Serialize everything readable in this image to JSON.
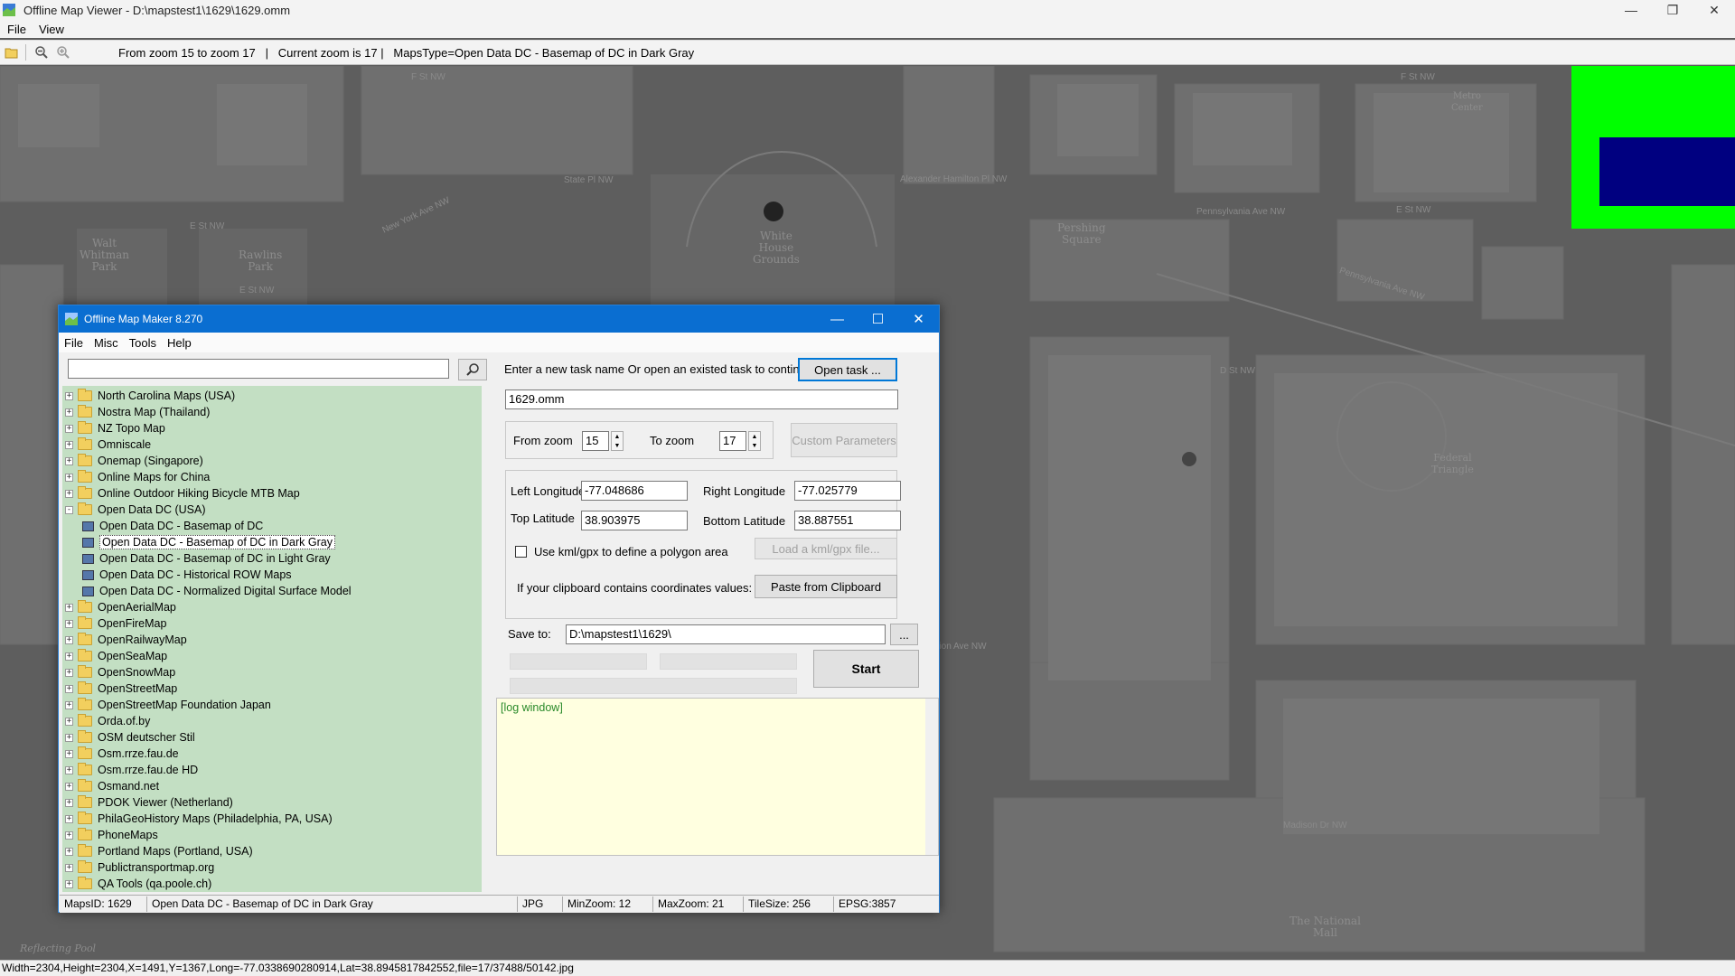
{
  "window": {
    "title": "Offline Map Viewer - D:\\mapstest1\\1629\\1629.omm",
    "controls": [
      "minimize",
      "restore",
      "close"
    ]
  },
  "menu": [
    "File",
    "View"
  ],
  "toolbar": {
    "status": "From zoom 15 to zoom 17   |   Current zoom is 17 |   MapsType=Open Data DC - Basemap of DC in Dark Gray"
  },
  "map": {
    "labels": {
      "walt": "Walt\nWhitman\nPark",
      "rawlins": "Rawlins\nPark",
      "white_house": "White\nHouse\nGrounds",
      "pershing": "Pershing\nSquare",
      "federal": "Federal\nTriangle",
      "national_mall": "The National\nMall",
      "metro": "Metro\nCenter",
      "reflecting": "Reflecting Pool"
    },
    "streets": {
      "f_st_1": "F St NW",
      "f_st_2": "F St NW",
      "e_st_1": "E St NW",
      "e_st_2": "E St NW",
      "e_st_3": "E St NW",
      "state_pl": "State Pl NW",
      "alexander": "Alexander Hamilton Pl NW",
      "penn_1": "Pennsylvania Ave NW",
      "penn_2": "Pennsylvania Ave NW",
      "d_st": "D St NW",
      "madison": "Madison Dr NW",
      "constitution": "Constitution Ave NW",
      "ny_ave": "New York Ave NW"
    },
    "overview_colors": {
      "background": "#00ff00",
      "viewport": "#000080"
    }
  },
  "status_bar": "Width=2304,Height=2304,X=1491,Y=1367,Long=-77.0338690280914,Lat=38.8945817842552,file=17/37488/50142.jpg",
  "dialog": {
    "title": "Offline Map Maker 8.270",
    "menu": [
      "File",
      "Misc",
      "Tools",
      "Help"
    ],
    "search_placeholder": "",
    "tree": [
      {
        "label": "North Carolina Maps (USA)",
        "type": "folder",
        "expander": "+"
      },
      {
        "label": "Nostra Map (Thailand)",
        "type": "folder",
        "expander": "+"
      },
      {
        "label": "NZ Topo Map",
        "type": "folder",
        "expander": "+"
      },
      {
        "label": "Omniscale",
        "type": "folder",
        "expander": "+"
      },
      {
        "label": "Onemap (Singapore)",
        "type": "folder",
        "expander": "+"
      },
      {
        "label": "Online Maps for China",
        "type": "folder",
        "expander": "+"
      },
      {
        "label": "Online Outdoor Hiking Bicycle MTB Map",
        "type": "folder",
        "expander": "+"
      },
      {
        "label": "Open Data DC (USA)",
        "type": "folder-open",
        "expander": "-"
      },
      {
        "label": "Open Data DC - Basemap of DC",
        "type": "map",
        "expander": ""
      },
      {
        "label": "Open Data DC - Basemap of DC in Dark Gray",
        "type": "map",
        "expander": "",
        "selected": true
      },
      {
        "label": "Open Data DC - Basemap of DC in Light Gray",
        "type": "map",
        "expander": ""
      },
      {
        "label": "Open Data DC - Historical ROW Maps",
        "type": "map",
        "expander": ""
      },
      {
        "label": "Open Data DC - Normalized Digital Surface Model",
        "type": "map",
        "expander": ""
      },
      {
        "label": "OpenAerialMap",
        "type": "folder",
        "expander": "+"
      },
      {
        "label": "OpenFireMap",
        "type": "folder",
        "expander": "+"
      },
      {
        "label": "OpenRailwayMap",
        "type": "folder",
        "expander": "+"
      },
      {
        "label": "OpenSeaMap",
        "type": "folder",
        "expander": "+"
      },
      {
        "label": "OpenSnowMap",
        "type": "folder",
        "expander": "+"
      },
      {
        "label": "OpenStreetMap",
        "type": "folder",
        "expander": "+"
      },
      {
        "label": "OpenStreetMap Foundation Japan",
        "type": "folder",
        "expander": "+"
      },
      {
        "label": "Orda.of.by",
        "type": "folder",
        "expander": "+"
      },
      {
        "label": "OSM deutscher Stil",
        "type": "folder",
        "expander": "+"
      },
      {
        "label": "Osm.rrze.fau.de",
        "type": "folder",
        "expander": "+"
      },
      {
        "label": "Osm.rrze.fau.de HD",
        "type": "folder",
        "expander": "+"
      },
      {
        "label": "Osmand.net",
        "type": "folder",
        "expander": "+"
      },
      {
        "label": "PDOK Viewer (Netherland)",
        "type": "folder",
        "expander": "+"
      },
      {
        "label": "PhilaGeoHistory Maps (Philadelphia, PA, USA)",
        "type": "folder",
        "expander": "+"
      },
      {
        "label": "PhoneMaps",
        "type": "folder",
        "expander": "+"
      },
      {
        "label": "Portland Maps (Portland, USA)",
        "type": "folder",
        "expander": "+"
      },
      {
        "label": "Publictransportmap.org",
        "type": "folder",
        "expander": "+"
      },
      {
        "label": "QA Tools (qa.poole.ch)",
        "type": "folder",
        "expander": "+"
      }
    ],
    "task_prompt": "Enter a new task name Or open an existed task to continue:",
    "open_task_button": "Open task ...",
    "task_name": "1629.omm",
    "from_zoom_label": "From zoom",
    "from_zoom": "15",
    "to_zoom_label": "To zoom",
    "to_zoom": "17",
    "custom_params_button": "Custom Parameters",
    "left_lon_label": "Left Longitude",
    "left_lon": "-77.048686",
    "right_lon_label": "Right Longitude",
    "right_lon": "-77.025779",
    "top_lat_label": "Top Latitude",
    "top_lat": "38.903975",
    "bottom_lat_label": "Bottom Latitude",
    "bottom_lat": "38.887551",
    "kml_checkbox_label": "Use kml/gpx to define a polygon area",
    "kml_button": "Load a kml/gpx file...",
    "clipboard_label": "If your clipboard contains coordinates values:",
    "clipboard_button": "Paste from Clipboard",
    "save_to_label": "Save to:",
    "save_to": "D:\\mapstest1\\1629\\",
    "browse_button": "...",
    "start_button": "Start",
    "log_text": "[log window]",
    "status": {
      "maps_id": "MapsID: 1629",
      "map_name": "Open Data DC - Basemap of DC in Dark Gray",
      "format": "JPG",
      "min_zoom": "MinZoom: 12",
      "max_zoom": "MaxZoom: 21",
      "tile_size": "TileSize: 256",
      "epsg": "EPSG:3857"
    }
  }
}
